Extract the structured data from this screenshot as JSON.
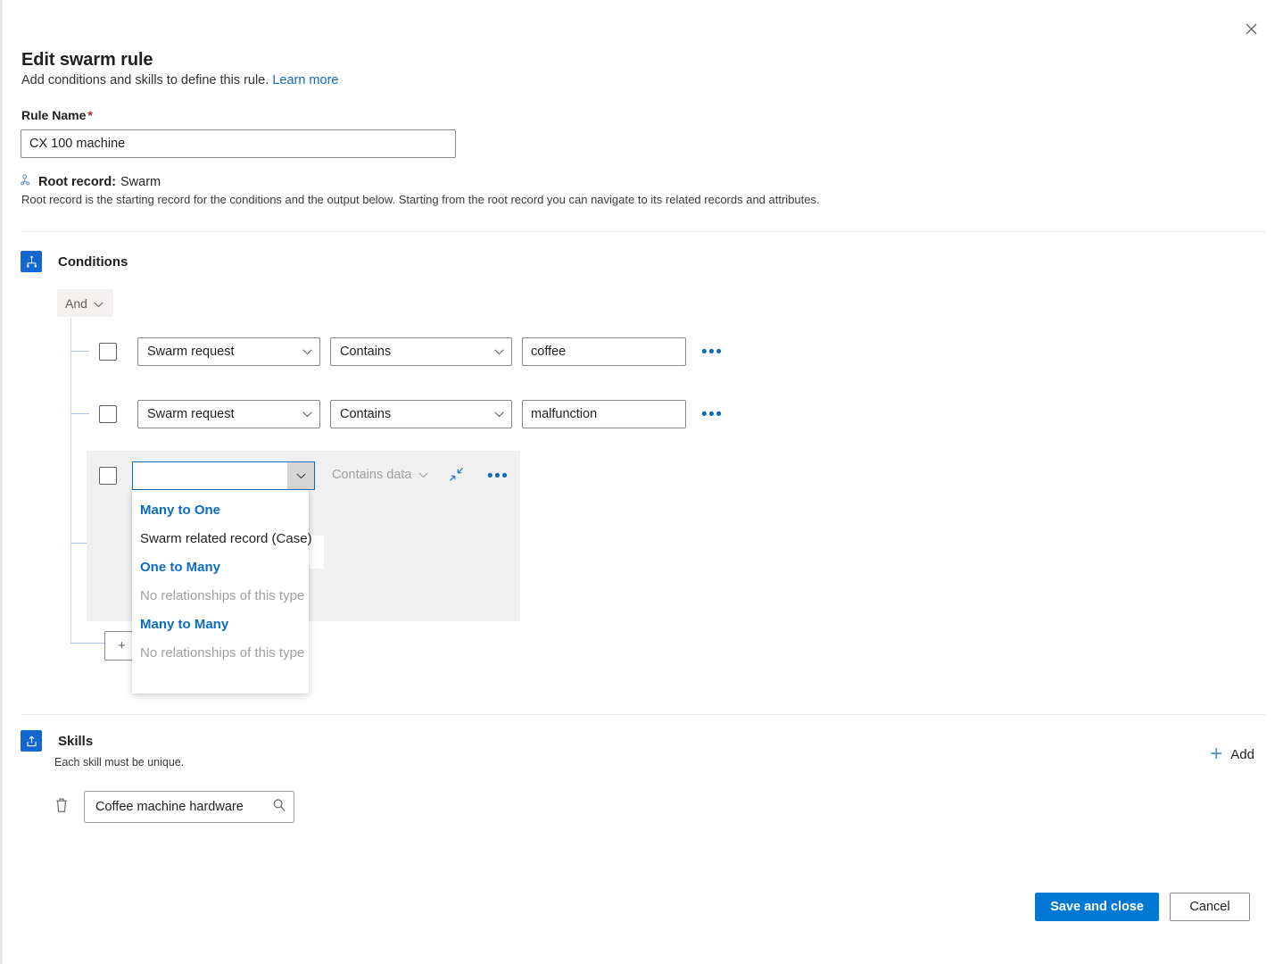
{
  "window": {
    "close_label": "×"
  },
  "header": {
    "title": "Edit swarm rule",
    "subtitle": "Add conditions and skills to define this rule.",
    "learn_more": "Learn more"
  },
  "rule_name": {
    "label": "Rule Name",
    "required_marker": "*",
    "value": "CX 100 machine",
    "placeholder": ""
  },
  "root_record": {
    "label": "Root record:",
    "value": "Swarm",
    "description": "Root record is the starting record for the conditions and the output below. Starting from the root record you can navigate to its related records and attributes."
  },
  "conditions": {
    "title": "Conditions",
    "logic_operator": "And",
    "rows": [
      {
        "attribute": "Swarm request",
        "operator": "Contains",
        "value": "coffee",
        "more_label": "•••"
      },
      {
        "attribute": "Swarm request",
        "operator": "Contains",
        "value": "malfunction",
        "more_label": "•••"
      },
      {
        "attribute": "",
        "operator": "Contains data",
        "value": "",
        "more_label": "•••"
      }
    ],
    "hidden_add_label": "+"
  },
  "relationship_dropdown": {
    "groups": [
      {
        "title": "Many to One",
        "items": [
          "Swarm related record (Case)"
        ],
        "empty_text": null
      },
      {
        "title": "One to Many",
        "items": [],
        "empty_text": "No relationships of this type"
      },
      {
        "title": "Many to Many",
        "items": [],
        "empty_text": "No relationships of this type"
      }
    ]
  },
  "skills": {
    "title": "Skills",
    "subtitle": "Each skill must be unique.",
    "add_label": "Add",
    "items": [
      {
        "value": "Coffee machine hardware",
        "placeholder": ""
      }
    ]
  },
  "footer": {
    "save_label": "Save and close",
    "cancel_label": "Cancel"
  },
  "colors": {
    "accent": "#0078d4",
    "link": "#0f6cbd",
    "section_icon_bg": "#1267d1",
    "required": "#a4262c",
    "tree_line": "#c7d8f0"
  }
}
